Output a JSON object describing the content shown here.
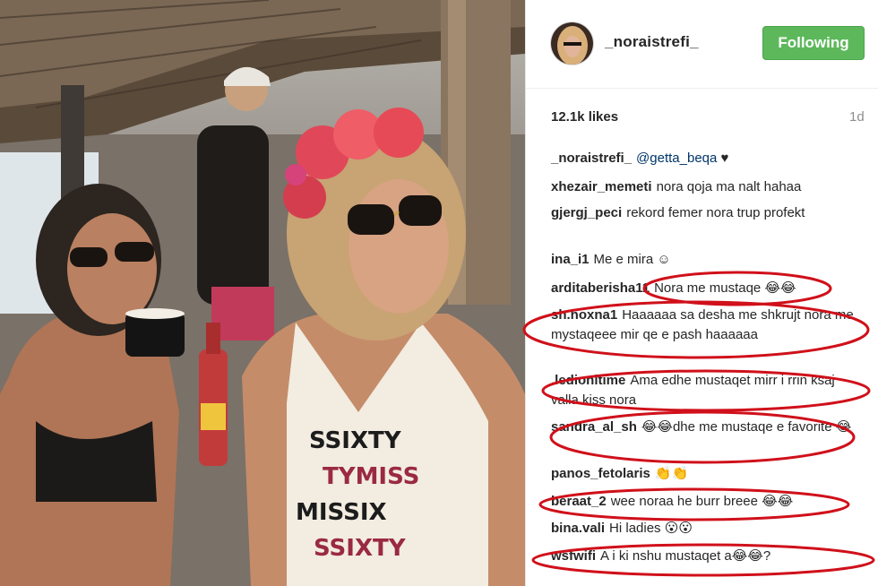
{
  "post": {
    "username": "_noraistrefi_",
    "follow_label": "Following",
    "likes": "12.1k likes",
    "time": "1d"
  },
  "comments": [
    {
      "user": "_noraistrefi_",
      "mention": "@getta_beqa",
      "text": "♥"
    },
    {
      "user": "xhezair_memeti",
      "text": "nora qoja ma nalt hahaa"
    },
    {
      "user": "gjergj_peci",
      "text": "rekord femer nora trup profekt"
    },
    {
      "user": "ina_i1",
      "text": "Me e mira ☺"
    },
    {
      "user": "arditaberisha11",
      "text": "Nora me mustaqe 😂😂"
    },
    {
      "user": "sh.hoxna1",
      "text": "Haaaaaa sa desha me shkrujt nora me mystaqeee mir qe e pash haaaaaa"
    },
    {
      "user": ".ledionitime",
      "text": "Ama edhe mustaqet mirr i rrin ksaj valla kiss nora"
    },
    {
      "user": "sandra_al_sh",
      "text": "😂😂dhe me mustaqe e favorite 😂"
    },
    {
      "user": "panos_fetolaris",
      "text": "👏👏"
    },
    {
      "user": "beraat_2",
      "text": "wee noraa he burr breee 😂😂"
    },
    {
      "user": "bina.vali",
      "text": "Hi ladies 😮😮"
    },
    {
      "user": "wsfwifi",
      "text": "A i ki nshu mustaqet a😂😂?"
    }
  ],
  "colors": {
    "follow_bg": "#5db85c",
    "annotation": "#d0101a"
  },
  "icons": {
    "heart": "heart-icon"
  }
}
